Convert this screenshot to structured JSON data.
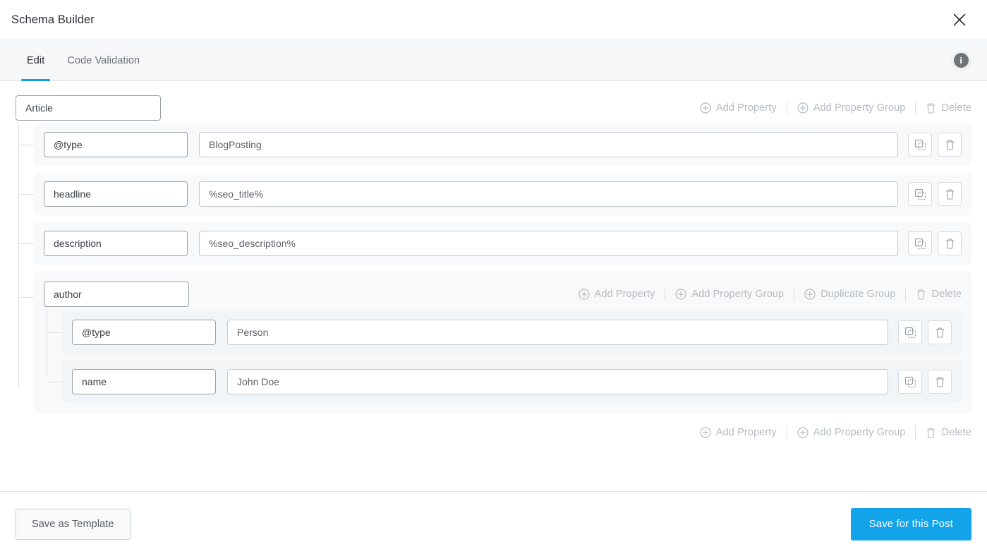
{
  "header": {
    "title": "Schema Builder",
    "close_icon": "close-icon"
  },
  "tabs": [
    {
      "label": "Edit",
      "active": true
    },
    {
      "label": "Code Validation",
      "active": false
    }
  ],
  "info_button": {
    "icon": "info-icon",
    "glyph": "i"
  },
  "root": {
    "name": "Article",
    "toolbar": [
      {
        "label": "Add Property",
        "icon": "plus-circle-icon"
      },
      {
        "label": "Add Property Group",
        "icon": "plus-circle-icon"
      },
      {
        "label": "Delete",
        "icon": "trash-icon"
      }
    ],
    "properties": [
      {
        "key": "@type",
        "value": "BlogPosting"
      },
      {
        "key": "headline",
        "value": "%seo_title%"
      },
      {
        "key": "description",
        "value": "%seo_description%"
      }
    ],
    "group": {
      "name": "author",
      "toolbar": [
        {
          "label": "Add Property",
          "icon": "plus-circle-icon"
        },
        {
          "label": "Add Property Group",
          "icon": "plus-circle-icon"
        },
        {
          "label": "Duplicate Group",
          "icon": "plus-circle-icon"
        },
        {
          "label": "Delete",
          "icon": "trash-icon"
        }
      ],
      "properties": [
        {
          "key": "@type",
          "value": "Person"
        },
        {
          "key": "name",
          "value": "John Doe"
        }
      ]
    },
    "bottom_toolbar": [
      {
        "label": "Add Property",
        "icon": "plus-circle-icon"
      },
      {
        "label": "Add Property Group",
        "icon": "plus-circle-icon"
      },
      {
        "label": "Delete",
        "icon": "trash-icon"
      }
    ]
  },
  "row_actions": {
    "duplicate_icon": "copy-icon",
    "delete_icon": "trash-icon"
  },
  "footer": {
    "save_template_label": "Save as Template",
    "save_post_label": "Save for this Post"
  },
  "colors": {
    "accent": "#13a3e8",
    "tab_underline": "#0ba0e2",
    "card_bg": "#f7f9fa",
    "toolbar_text": "#b4bbc2",
    "border": "#dfe3e8"
  }
}
